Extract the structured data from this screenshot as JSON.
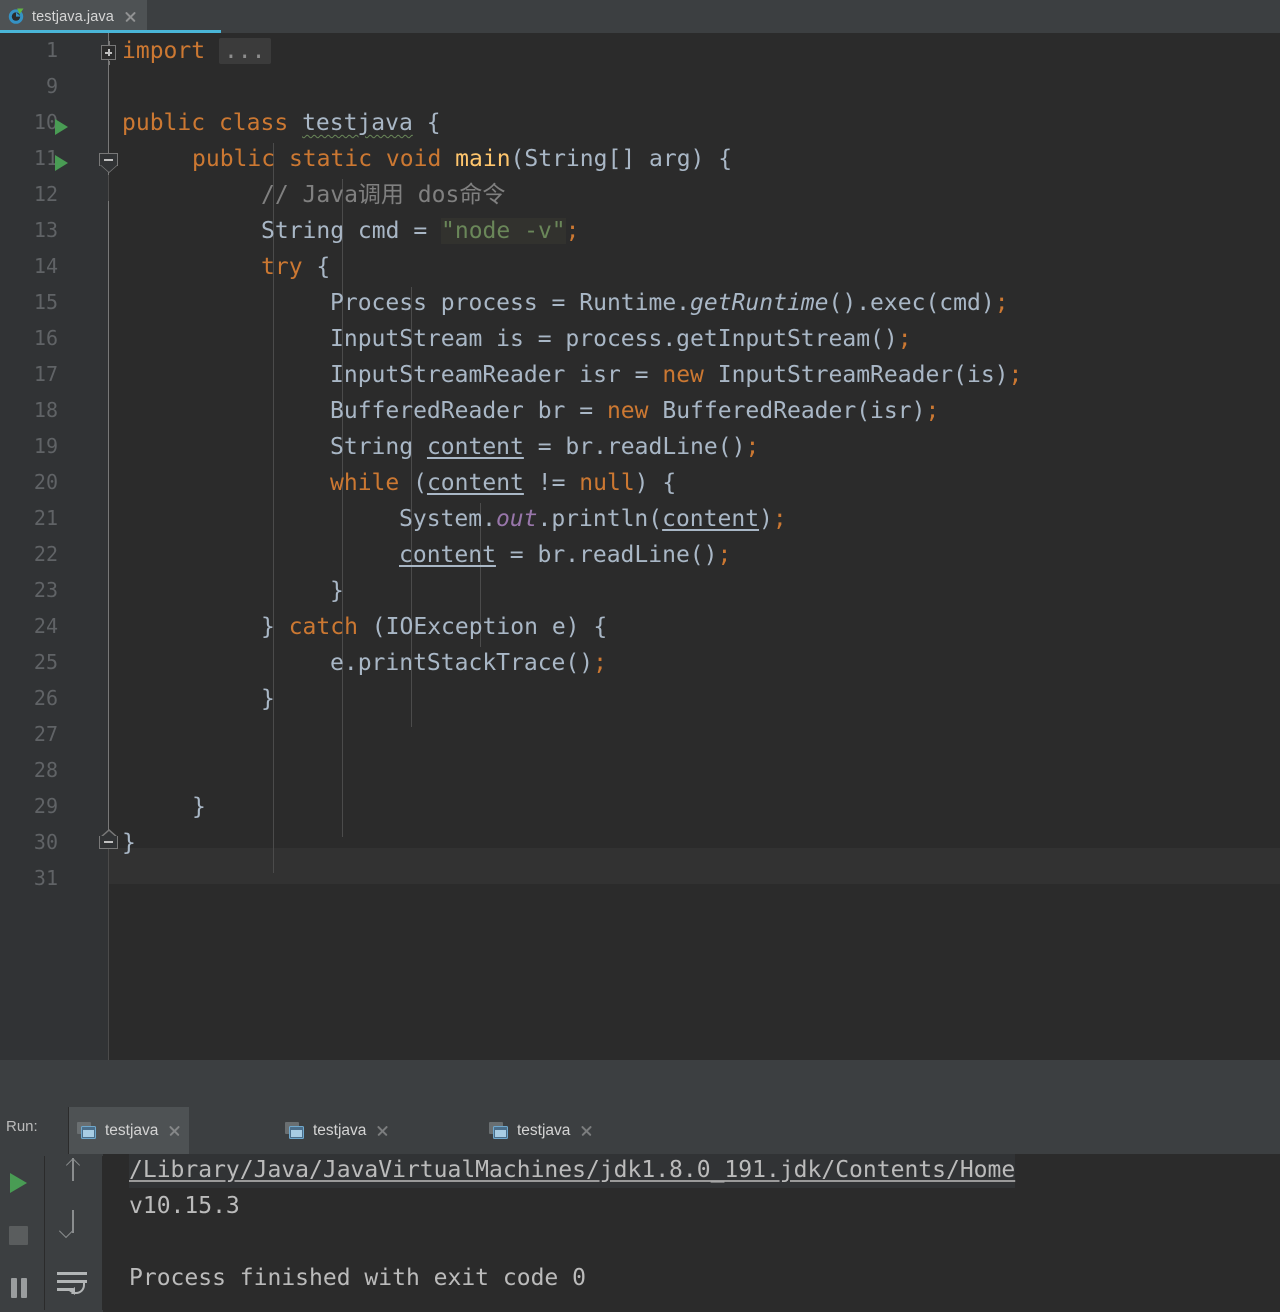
{
  "editor_tab": {
    "filename": "testjava.java",
    "icon": "java-class-runnable-icon",
    "close_icon": "close-icon",
    "accent_color": "#4ab6d8"
  },
  "theme": {
    "editor_bg": "#2b2b2b",
    "gutter_bg": "#313335",
    "panel_bg": "#3c3f41",
    "default_text": "#a9b7c6",
    "keyword": "#cc7832",
    "string": "#6a8759",
    "comment": "#808080",
    "method": "#ffc66d",
    "static_field": "#9876aa",
    "line_number": "#606366",
    "caret_line_bg": "#323232",
    "run_green": "#499c54"
  },
  "gutter": {
    "line_numbers": [
      "1",
      "9",
      "10",
      "11",
      "12",
      "13",
      "14",
      "15",
      "16",
      "17",
      "18",
      "19",
      "20",
      "21",
      "22",
      "23",
      "24",
      "25",
      "26",
      "27",
      "28",
      "29",
      "30",
      "31"
    ],
    "run_markers": [
      "10",
      "11"
    ],
    "fold_markers": [
      {
        "line": "1",
        "type": "collapsed-plus"
      },
      {
        "line": "11",
        "type": "region-start"
      },
      {
        "line": "29",
        "type": "region-end"
      }
    ]
  },
  "code": {
    "caret_line": "30",
    "lines": [
      {
        "n": "1",
        "text": "import ..."
      },
      {
        "n": "9",
        "text": ""
      },
      {
        "n": "10",
        "text": "public class testjava {"
      },
      {
        "n": "11",
        "text": "    public static void main(String[] arg) {"
      },
      {
        "n": "12",
        "text": "        // Java调用 dos命令"
      },
      {
        "n": "13",
        "text": "        String cmd = \"node -v\";"
      },
      {
        "n": "14",
        "text": "        try {"
      },
      {
        "n": "15",
        "text": "            Process process = Runtime.getRuntime().exec(cmd);"
      },
      {
        "n": "16",
        "text": "            InputStream is = process.getInputStream();"
      },
      {
        "n": "17",
        "text": "            InputStreamReader isr = new InputStreamReader(is);"
      },
      {
        "n": "18",
        "text": "            BufferedReader br = new BufferedReader(isr);"
      },
      {
        "n": "19",
        "text": "            String content = br.readLine();"
      },
      {
        "n": "20",
        "text": "            while (content != null) {"
      },
      {
        "n": "21",
        "text": "                System.out.println(content);"
      },
      {
        "n": "22",
        "text": "                content = br.readLine();"
      },
      {
        "n": "23",
        "text": "            }"
      },
      {
        "n": "24",
        "text": "        } catch (IOException e) {"
      },
      {
        "n": "25",
        "text": "            e.printStackTrace();"
      },
      {
        "n": "26",
        "text": "        }"
      },
      {
        "n": "27",
        "text": ""
      },
      {
        "n": "28",
        "text": ""
      },
      {
        "n": "29",
        "text": "    }"
      },
      {
        "n": "30",
        "text": "}"
      },
      {
        "n": "31",
        "text": ""
      }
    ],
    "tokens": {
      "import_kw": "import",
      "fold_ellipsis": "...",
      "public": "public",
      "class": "class",
      "class_name": "testjava",
      "brace_open": "{",
      "static": "static",
      "void": "void",
      "main": "main",
      "main_params": "(String[] arg) {",
      "comment12": "// Java调用 dos命令",
      "string_decl": "String cmd = ",
      "string_lit": "\"node -v\"",
      "semi": ";",
      "try": "try",
      "l15a": "Process process = Runtime.",
      "l15b": "getRuntime",
      "l15c": "().exec(cmd)",
      "l16": "InputStream is = process.getInputStream()",
      "l17a": "InputStreamReader isr = ",
      "new": "new",
      "l17b": " InputStreamReader(is)",
      "l18a": "BufferedReader br = ",
      "l18b": " BufferedReader(isr)",
      "l19a": "String ",
      "content": "content",
      "l19b": " = br.readLine()",
      "while": "while",
      "l20a": " (",
      "l20b": " != ",
      "null": "null",
      "l20c": ") {",
      "l21a": "System.",
      "out": "out",
      "l21b": ".println(",
      "l21c": ")",
      "l22b": " = br.readLine()",
      "brace_close": "}",
      "catch_prefix": "} ",
      "catch": "catch",
      "catch_params": " (IOException e) {",
      "l25": "e.printStackTrace()"
    }
  },
  "run_panel": {
    "label": "Run:",
    "tabs": [
      {
        "label": "testjava",
        "icon": "console-window-icon",
        "active": true,
        "close_icon": "close-icon"
      },
      {
        "label": "testjava",
        "icon": "console-window-icon",
        "active": false,
        "close_icon": "close-icon"
      },
      {
        "label": "testjava",
        "icon": "console-window-icon",
        "active": false,
        "close_icon": "close-icon"
      }
    ],
    "toolbar": [
      {
        "name": "rerun-button",
        "icon": "play-icon"
      },
      {
        "name": "stop-button",
        "icon": "stop-icon"
      },
      {
        "name": "pause-button",
        "icon": "pause-icon"
      },
      {
        "name": "up-stack-button",
        "icon": "arrow-up-icon"
      },
      {
        "name": "down-stack-button",
        "icon": "arrow-down-icon"
      },
      {
        "name": "soft-wrap-button",
        "icon": "soft-wrap-icon"
      }
    ],
    "console": {
      "command_path": "/Library/Java/JavaVirtualMachines/jdk1.8.0_191.jdk/Contents/Home",
      "output_version": "v10.15.3",
      "exit_message": "Process finished with exit code 0"
    }
  }
}
